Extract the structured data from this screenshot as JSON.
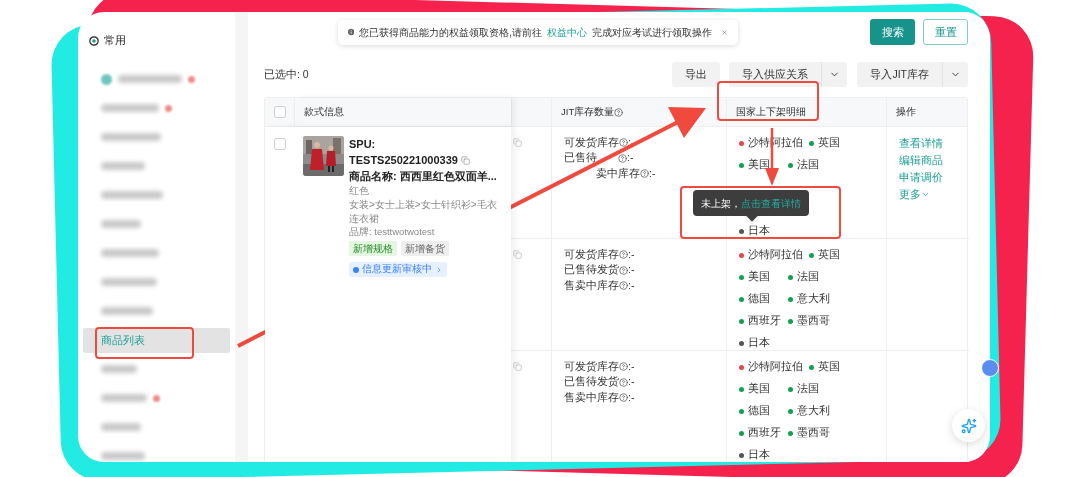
{
  "sidebar": {
    "pinned": {
      "label": "常用"
    },
    "items": [
      {
        "kind": "group",
        "dot": true,
        "selected": false
      },
      {
        "kind": "blurred",
        "dot": true,
        "selected": false
      },
      {
        "kind": "blurred",
        "dot": false,
        "selected": false
      },
      {
        "kind": "blurred",
        "dot": false,
        "selected": false
      },
      {
        "kind": "blurred",
        "dot": false,
        "selected": false
      },
      {
        "kind": "blurred",
        "dot": false,
        "selected": false
      },
      {
        "kind": "blurred",
        "dot": false,
        "selected": false
      },
      {
        "kind": "blurred",
        "dot": false,
        "selected": false
      },
      {
        "kind": "blurred",
        "dot": false,
        "selected": false
      },
      {
        "kind": "link",
        "label": "商品列表",
        "selected": true
      },
      {
        "kind": "blurred",
        "dot": false,
        "selected": false
      },
      {
        "kind": "blurred",
        "dot": true,
        "selected": false
      },
      {
        "kind": "blurred",
        "dot": false,
        "selected": false
      },
      {
        "kind": "blurred",
        "dot": false,
        "selected": false
      }
    ]
  },
  "notice": {
    "text": "您已获得商品能力的权益领取资格,请前往",
    "link": "权益中心",
    "text_after": "完成对应考试进行领取操作"
  },
  "header_buttons": [
    {
      "label": "搜索",
      "kind": "primary"
    },
    {
      "label": "重置",
      "kind": "outline"
    }
  ],
  "selection": {
    "text": "已选中: 0"
  },
  "toolbar": [
    {
      "label": "导出",
      "kind": "plain"
    },
    {
      "label": "导入供应关系",
      "kind": "split"
    },
    {
      "label": "导入JIT库存",
      "kind": "split"
    }
  ],
  "table": {
    "columns": [
      {
        "kind": "checkbox",
        "checked": false
      },
      {
        "kind": "text",
        "label": "款式信息"
      },
      {
        "kind": "blank"
      },
      {
        "kind": "text",
        "label": "JIT库存数量",
        "help": true
      },
      {
        "kind": "text",
        "label": "国家上下架明细"
      },
      {
        "kind": "text",
        "label": "操作"
      }
    ],
    "rows": [
      {
        "checked": false,
        "style": {
          "spu_label": "SPU:",
          "spu": "TESTS250221000339",
          "name": "商品名称: 西西里红色双面羊...",
          "spec": "红色",
          "category": "女装>女士上装>女士针织衫>毛衣连衣裙",
          "brand": "品牌: testtwotwotest",
          "tags": [
            {
              "label": "新增规格",
              "kind": "green"
            },
            {
              "label": "新增备货",
              "kind": "gray"
            }
          ],
          "status": {
            "label": "信息更新审核中"
          }
        },
        "stock": [
          {
            "label": "可发货库存",
            "value": ":-"
          },
          {
            "label": "已售待",
            "gap_after": true,
            "value": ":-"
          },
          {
            "label": "卖中库存",
            "gap_before": true,
            "value": ":-"
          }
        ],
        "countries": [
          {
            "kind": "country",
            "name": "沙特阿拉伯",
            "color": "#e0474f"
          },
          {
            "kind": "country",
            "name": "英国",
            "color": "#12a150"
          },
          {
            "kind": "country",
            "name": "美国",
            "color": "#12a150"
          },
          {
            "kind": "country",
            "name": "法国",
            "color": "#12a150"
          },
          {
            "kind": "tooltip",
            "text": "未上架，",
            "link": "点击查看详情"
          },
          {
            "kind": "country",
            "name": "日本",
            "color": "#555555"
          }
        ],
        "actions": [
          {
            "label": "查看详情"
          },
          {
            "label": "编辑商品"
          },
          {
            "label": "申请调价"
          },
          {
            "label": "更多",
            "menu": true
          }
        ]
      },
      {
        "stock": [
          {
            "label": "可发货库存",
            "value": ":-"
          },
          {
            "label": "已售待发货",
            "value": ":-"
          },
          {
            "label": "售卖中库存",
            "value": ":-"
          }
        ],
        "countries": [
          {
            "kind": "country",
            "name": "沙特阿拉伯",
            "color": "#e0474f"
          },
          {
            "kind": "country",
            "name": "英国",
            "color": "#12a150"
          },
          {
            "kind": "country",
            "name": "美国",
            "color": "#12a150"
          },
          {
            "kind": "country",
            "name": "法国",
            "color": "#12a150"
          },
          {
            "kind": "country",
            "name": "德国",
            "color": "#12a150"
          },
          {
            "kind": "country",
            "name": "意大利",
            "color": "#12a150"
          },
          {
            "kind": "country",
            "name": "西班牙",
            "color": "#12a150"
          },
          {
            "kind": "country",
            "name": "墨西哥",
            "color": "#12a150"
          },
          {
            "kind": "country",
            "name": "日本",
            "color": "#555555"
          }
        ]
      },
      {
        "stock": [
          {
            "label": "可发货库存",
            "value": ":-"
          },
          {
            "label": "已售待发货",
            "value": ":-"
          },
          {
            "label": "售卖中库存",
            "value": ":-"
          }
        ],
        "countries": [
          {
            "kind": "country",
            "name": "沙特阿拉伯",
            "color": "#e0474f"
          },
          {
            "kind": "country",
            "name": "英国",
            "color": "#12a150"
          },
          {
            "kind": "country",
            "name": "美国",
            "color": "#12a150"
          },
          {
            "kind": "country",
            "name": "法国",
            "color": "#12a150"
          },
          {
            "kind": "country",
            "name": "德国",
            "color": "#12a150"
          },
          {
            "kind": "country",
            "name": "意大利",
            "color": "#12a150"
          },
          {
            "kind": "country",
            "name": "西班牙",
            "color": "#12a150"
          },
          {
            "kind": "country",
            "name": "墨西哥",
            "color": "#12a150"
          },
          {
            "kind": "country",
            "name": "日本",
            "color": "#555555"
          }
        ]
      }
    ]
  }
}
